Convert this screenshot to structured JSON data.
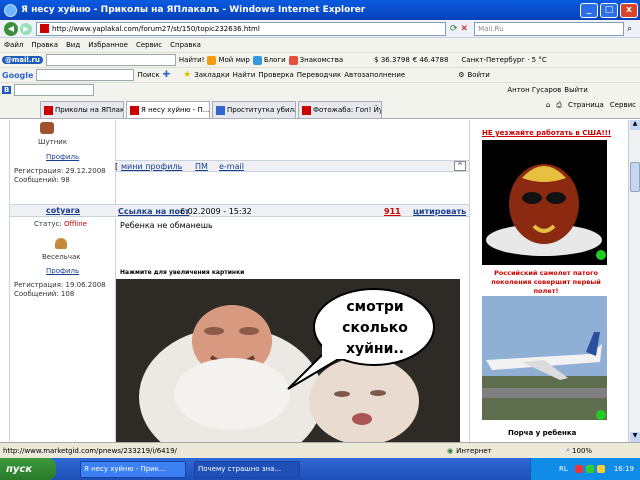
{
  "window": {
    "title": "Я несу хуйню - Приколы на ЯПлакалъ - Windows Internet Explorer",
    "min": "_",
    "max": "□",
    "close": "x"
  },
  "address": {
    "url": "http://www.yaplakal.com/forum27/st/150/topic232636.html",
    "search_placeholder": "Mail.Ru"
  },
  "menu": [
    "Файл",
    "Правка",
    "Вид",
    "Избранное",
    "Сервис",
    "Справка"
  ],
  "toolbar1": {
    "logo": "@mail.ru",
    "find": "Найти!",
    "items": [
      "Мой мир",
      "Блоги",
      "Знакомства"
    ],
    "usd": "$ 36.3798",
    "eur": "€ 46.4788",
    "weather": "Санкт-Петербург · 5 °С"
  },
  "toolbar2": {
    "logo": "Google",
    "search": "Поиск",
    "bookmarks": "Закладки",
    "find": "Найти",
    "check": "Проверка",
    "translate": "Переводчик",
    "autofill": "Автозаполнение",
    "login": "Войти"
  },
  "toolbar3": {
    "user": "Антон Гусаров",
    "exit": "Выйти"
  },
  "tabs": [
    {
      "label": "Приколы на ЯПлакалъ ...",
      "active": false
    },
    {
      "label": "Я несу хуйню - П...",
      "active": true
    },
    {
      "label": "Проститутка убила ...",
      "active": false
    },
    {
      "label": "Фотожаба: Гоп! Йух...",
      "active": false
    }
  ],
  "tab_tools": {
    "page": "Страница",
    "service": "Сервис"
  },
  "user1": {
    "rank": "Шутник",
    "profile": "Профиль",
    "reg": "Регистрация: 29.12.2008",
    "msgs": "Сообщений: 98"
  },
  "bar1": {
    "mini": "мини профиль",
    "pm": "ПМ",
    "email": "e-mail"
  },
  "user2": {
    "name": "cotyara",
    "status_label": "Статус:",
    "status": "Offline",
    "rank": "Весельчак",
    "profile": "Профиль",
    "reg": "Регистрация: 19.06.2008",
    "msgs": "Сообщений: 108"
  },
  "post2": {
    "link": "Ссылка на пост",
    "date": "6.02.2009 - 15:32",
    "rating": "911",
    "quote": "цитировать",
    "text": "Ребенка не обманешь",
    "enlarge": "Нажмите для увеличения картинки",
    "bubble": [
      "смотри",
      "сколько",
      "хуйни.."
    ]
  },
  "ads": {
    "title": "НЕ уезжайте работать в США!!!",
    "caption": "Российский самолет патого поколения совершит первый полет!",
    "bottom": "Порча у ребенка"
  },
  "status": {
    "url": "http://www.marketgid.com/pnews/233219/i/6419/",
    "zone": "Интернет",
    "zoom": "100%"
  },
  "taskbar": {
    "start": "пуск",
    "tasks": [
      "Я несу хуйню - Прик...",
      "Почему страшно зна..."
    ],
    "lang": "RL",
    "time": "16:19"
  }
}
